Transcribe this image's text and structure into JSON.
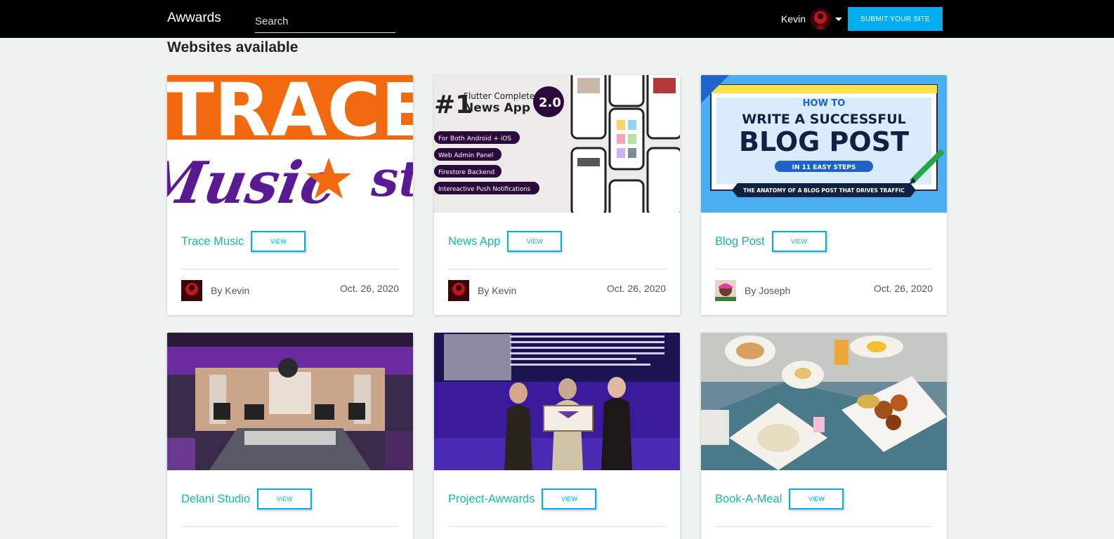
{
  "nav": {
    "brand": "Awwards",
    "search_placeholder": "Search",
    "user_name": "Kevin",
    "submit_label": "SUBMIT YOUR SITE",
    "accent_color": "#00aeef"
  },
  "page": {
    "section_title": "Websites available"
  },
  "projects": [
    {
      "title": "Trace Music",
      "view_label": "VIEW",
      "author": "By Kevin",
      "date": "Oct. 26, 2020",
      "thumb_text": [
        "TRACE",
        "Music",
        "st"
      ]
    },
    {
      "title": "News App",
      "view_label": "VIEW",
      "author": "By Kevin",
      "date": "Oct. 26, 2020",
      "thumb_text": [
        "#1",
        "Flutter Complete",
        "News App",
        "2.0",
        "For Both Android + iOS",
        "Web Admin Panel",
        "Firestore Backend",
        "Intereactive Push Notifications"
      ]
    },
    {
      "title": "Blog Post",
      "view_label": "VIEW",
      "author": "By Joseph",
      "date": "Oct. 26, 2020",
      "thumb_text": [
        "HOW TO",
        "WRITE A SUCCESSFUL",
        "BLOG POST",
        "IN 11 EASY STEPS",
        "THE ANATOMY OF A BLOG POST THAT DRIVES TRAFFIC"
      ]
    },
    {
      "title": "Delani Studio",
      "view_label": "VIEW"
    },
    {
      "title": "Project-Awwards",
      "view_label": "VIEW"
    },
    {
      "title": "Book-A-Meal",
      "view_label": "VIEW"
    }
  ]
}
